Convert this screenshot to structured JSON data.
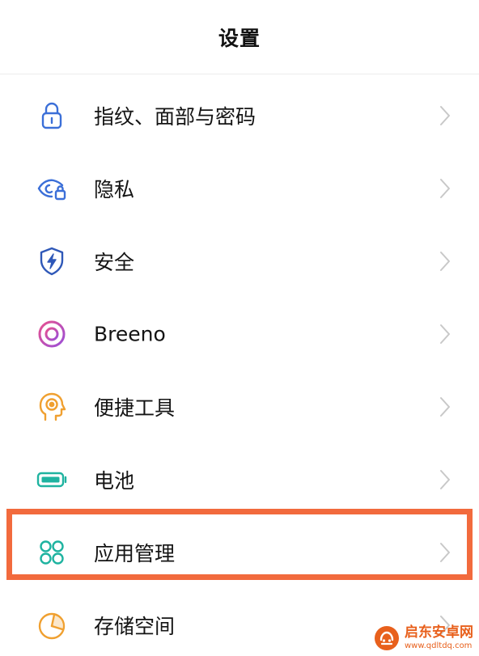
{
  "header": {
    "title": "设置"
  },
  "settings": {
    "items": [
      {
        "label": "指纹、面部与密码",
        "icon": "lock-icon",
        "color": "#3b6fd8"
      },
      {
        "label": "隐私",
        "icon": "eye-lock-icon",
        "color": "#3b6fd8"
      },
      {
        "label": "安全",
        "icon": "shield-bolt-icon",
        "color": "#2f58b8"
      },
      {
        "label": "Breeno",
        "icon": "breeno-ring-icon",
        "color": "#c04bd6"
      },
      {
        "label": "便捷工具",
        "icon": "head-target-icon",
        "color": "#f0a030"
      },
      {
        "label": "电池",
        "icon": "battery-icon",
        "color": "#1fb3a0"
      },
      {
        "label": "应用管理",
        "icon": "apps-grid-icon",
        "color": "#1fb3a0"
      },
      {
        "label": "存储空间",
        "icon": "pie-chart-icon",
        "color": "#f0a030"
      }
    ],
    "highlighted_index": 6,
    "highlight_color": "#f26a3d"
  },
  "watermark": {
    "name": "启东安卓网",
    "url": "www.qdltdq.com"
  }
}
